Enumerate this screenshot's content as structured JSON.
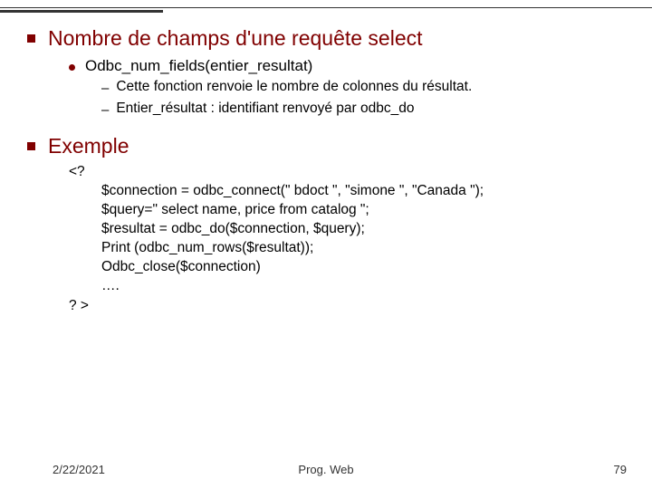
{
  "headings": {
    "h1a": "Nombre de champs d'une requête select",
    "h1b": "Exemple"
  },
  "sub": {
    "func": "Odbc_num_fields(entier_resultat)",
    "d1": "Cette fonction renvoie le nombre de colonnes du résultat.",
    "d2": "Entier_résultat : identifiant renvoyé par odbc_do"
  },
  "code": {
    "open": "<?",
    "l1": "$connection = odbc_connect(\" bdoct \", \"simone \", \"Canada \");",
    "l2": "$query=\" select name, price from catalog \";",
    "l3": "$resultat = odbc_do($connection, $query);",
    "l4": "Print (odbc_num_rows($resultat));",
    "l5": "Odbc_close($connection)",
    "l6": "….",
    "close": "? >"
  },
  "footer": {
    "date": "2/22/2021",
    "title": "Prog. Web",
    "page": "79"
  }
}
